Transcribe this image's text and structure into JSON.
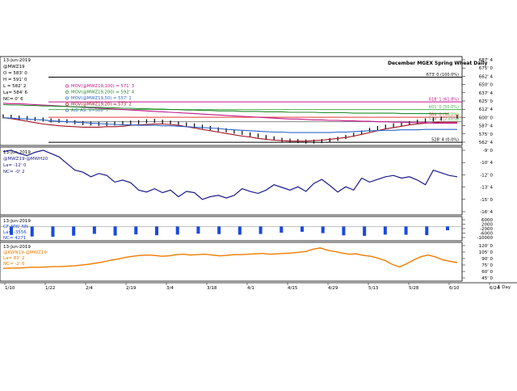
{
  "chart_data": [
    {
      "type": "line",
      "panel": "price",
      "title": "December MGEX Spring Wheat Daily",
      "header_date": "13-Jun-2019",
      "symbol": "@MWZ19",
      "ohlc": {
        "o": "O = 583' 0",
        "h": "H = 591' 0",
        "l": "L = 582' 2",
        "last": "La= 584' 6",
        "nc": "NC= 0' 6"
      },
      "legend": [
        {
          "text": "MOV(@MWZ19,100) = 571' 3",
          "color": "#c8148c"
        },
        {
          "text": "MOV(@MWZ19,200) = 592' 4",
          "color": "#1f8c2a"
        },
        {
          "text": "MOV(@MWZ19,50) = 557' 1",
          "color": "#2a64c8"
        },
        {
          "text": "MOV(@MWZ19,20) = 573' 2",
          "color": "#a0141e"
        },
        {
          "text": "A/D AS: V=508' 7",
          "color": "#2a64c8"
        }
      ],
      "retracements": [
        {
          "label": "673' 0 (100.0%)",
          "value": 673.0,
          "color": "#000000"
        },
        {
          "label": "618' 1 (61.8%)",
          "value": 618.1,
          "color": "#c8148c"
        },
        {
          "label": "601' 0 (50.0%)",
          "value": 601.0,
          "color": "#4caf50"
        },
        {
          "label": "584' 0 (38.2%)",
          "value": 584.0,
          "color": "#e53935"
        },
        {
          "label": "574' 2 (23.6%)",
          "value": 574.2,
          "color": "#888888"
        },
        {
          "label": "528' 4 (0.0%)",
          "value": 528.4,
          "color": "#000000"
        }
      ],
      "y_ticks": [
        "687' 4",
        "675' 0",
        "662' 4",
        "650' 0",
        "637' 4",
        "625' 0",
        "612' 4",
        "600' 0",
        "587' 4",
        "575' 0",
        "562' 4"
      ],
      "ylim": [
        525,
        690
      ],
      "series": [
        {
          "name": "@MWZ19",
          "values": [
            586,
            585,
            583,
            582,
            580,
            579,
            577,
            576,
            575,
            573,
            571,
            570,
            569,
            569,
            570,
            571,
            572,
            573,
            575,
            576,
            574,
            572,
            570,
            568,
            566,
            563,
            560,
            557,
            555,
            552,
            549,
            546,
            543,
            540,
            537,
            534,
            532,
            531,
            530,
            530,
            531,
            533,
            536,
            540,
            545,
            550,
            556,
            560,
            563,
            566,
            568,
            571,
            574,
            577,
            579,
            581,
            583,
            585
          ]
        },
        {
          "name": "MOV 20",
          "values": [
            583,
            581,
            578,
            575,
            572,
            569,
            567,
            565,
            564,
            563,
            562,
            562,
            562,
            563,
            563,
            564,
            566,
            567,
            568,
            569,
            569,
            568,
            566,
            563,
            560,
            557,
            554,
            551,
            548,
            545,
            542,
            540,
            537,
            535,
            533,
            532,
            531,
            531,
            531,
            532,
            533,
            535,
            537,
            539,
            542,
            546,
            550,
            554,
            558,
            561,
            564,
            567,
            569,
            571,
            572,
            573,
            573,
            573
          ]
        },
        {
          "name": "MOV 50",
          "values": [
            583,
            582,
            581,
            580,
            579,
            578,
            576,
            575,
            574,
            573,
            572,
            571,
            570,
            569,
            568,
            567,
            567,
            566,
            566,
            566,
            565,
            565,
            564,
            563,
            562,
            561,
            560,
            559,
            557,
            556,
            555,
            554,
            553,
            552,
            551,
            551,
            550,
            550,
            550,
            550,
            550,
            550,
            551,
            551,
            552,
            553,
            554,
            554,
            555,
            555,
            556,
            556,
            556,
            557,
            557,
            557,
            557,
            557
          ]
        },
        {
          "name": "MOV 100",
          "values": [
            615,
            614,
            614,
            613,
            612,
            611,
            610,
            609,
            608,
            607,
            606,
            605,
            604,
            603,
            602,
            601,
            600,
            599,
            598,
            597,
            596,
            595,
            594,
            593,
            592,
            591,
            590,
            589,
            588,
            587,
            586,
            585,
            584,
            583,
            582,
            581,
            580,
            580,
            579,
            578,
            578,
            577,
            577,
            576,
            576,
            575,
            575,
            574,
            574,
            573,
            573,
            572,
            572,
            572,
            571,
            571,
            571,
            571
          ]
        },
        {
          "name": "MOV 200",
          "values": [
            612,
            611,
            611,
            610,
            610,
            609,
            609,
            608,
            608,
            607,
            607,
            606,
            606,
            605,
            605,
            604,
            604,
            603,
            603,
            602,
            602,
            601,
            601,
            600,
            600,
            599,
            599,
            598,
            598,
            598,
            597,
            597,
            597,
            596,
            596,
            596,
            595,
            595,
            595,
            595,
            594,
            594,
            594,
            594,
            593,
            593,
            593,
            593,
            593,
            593,
            592,
            592,
            592,
            592,
            592,
            592,
            592,
            592
          ]
        }
      ]
    },
    {
      "type": "line",
      "panel": "spread",
      "header_date": "13-Jun-2019",
      "symbol": "@MWZ19-@MWH20",
      "last": "La= -12' 0",
      "nc": "NC= -0' 2",
      "y_ticks": [
        "-9' 0",
        "-10' 4",
        "-12' 0",
        "-13' 4",
        "-15' 0",
        "-16' 4"
      ],
      "ylim": [
        -17.5,
        -8
      ],
      "values": [
        -8.2,
        -8.0,
        -8.5,
        -8.8,
        -8.3,
        -8.0,
        -8.5,
        -9.0,
        -10.0,
        -11.0,
        -11.3,
        -12.0,
        -11.5,
        -11.8,
        -12.8,
        -12.5,
        -12.9,
        -14.0,
        -14.3,
        -13.8,
        -14.4,
        -14.0,
        -15.0,
        -14.2,
        -14.4,
        -15.4,
        -15.0,
        -14.8,
        -15.2,
        -14.8,
        -13.8,
        -14.2,
        -14.5,
        -14.0,
        -13.2,
        -13.6,
        -14.0,
        -13.5,
        -14.2,
        -13.0,
        -12.4,
        -13.3,
        -14.3,
        -13.5,
        -14.0,
        -12.2,
        -12.8,
        -12.4,
        -12.0,
        -11.8,
        -12.2,
        -12.0,
        -12.5,
        -13.2,
        -11.0,
        -11.4,
        -11.8,
        -12.0
      ]
    },
    {
      "type": "bar",
      "panel": "cot",
      "header_date": "13-Jun-2019",
      "symbol": "CF_MW_NN",
      "last": "La= -3556",
      "nc": "NC= 4271",
      "y_ticks": [
        "6000",
        "2000",
        "-2000",
        "-6000",
        "-10000"
      ],
      "ylim": [
        -12000,
        8000
      ],
      "values": [
        -8000,
        -9500,
        -9800,
        -8700,
        -7000,
        -8600,
        -7500,
        -8300,
        -7700,
        -6800,
        -7200,
        -7800,
        -7100,
        -5900,
        -5000,
        -6300,
        -8400,
        -8900,
        -7700,
        -7800,
        -8200,
        -3556
      ]
    },
    {
      "type": "line",
      "panel": "ratio",
      "header_date": "13-Jun-2019",
      "symbol": "@KWN19-@MWZ19",
      "last": "La= 83' 2",
      "nc": "NC= -2' 6",
      "y_ticks": [
        "120' 0",
        "105' 0",
        "90' 0",
        "75' 0",
        "60' 0",
        "45' 0"
      ],
      "ylim": [
        40,
        130
      ],
      "values": [
        68,
        69,
        69,
        70,
        71,
        71,
        72,
        73,
        73,
        74,
        75,
        77,
        79,
        82,
        85,
        89,
        92,
        96,
        99,
        101,
        102,
        101,
        99,
        100,
        103,
        104,
        102,
        103,
        104,
        102,
        100,
        101,
        103,
        103,
        104,
        105,
        106,
        104,
        105,
        106,
        107,
        109,
        111,
        117,
        120,
        114,
        111,
        107,
        104,
        105,
        101,
        99,
        94,
        88,
        78,
        72,
        80,
        90,
        98,
        102,
        97,
        90,
        86,
        83
      ]
    }
  ],
  "x_axis": {
    "dates": [
      "1/10",
      "1/22",
      "2/4",
      "2/19",
      "3/4",
      "3/18",
      "4/1",
      "4/15",
      "4/29",
      "5/13",
      "5/28",
      "6/10",
      "6/24"
    ],
    "unit_label": "1 Day"
  },
  "colors": {
    "bars": "#1a49e0",
    "ratio_line": "#ef7b00",
    "spread_line": "#1a1a8c",
    "highlight_box": "#aaffaa"
  }
}
